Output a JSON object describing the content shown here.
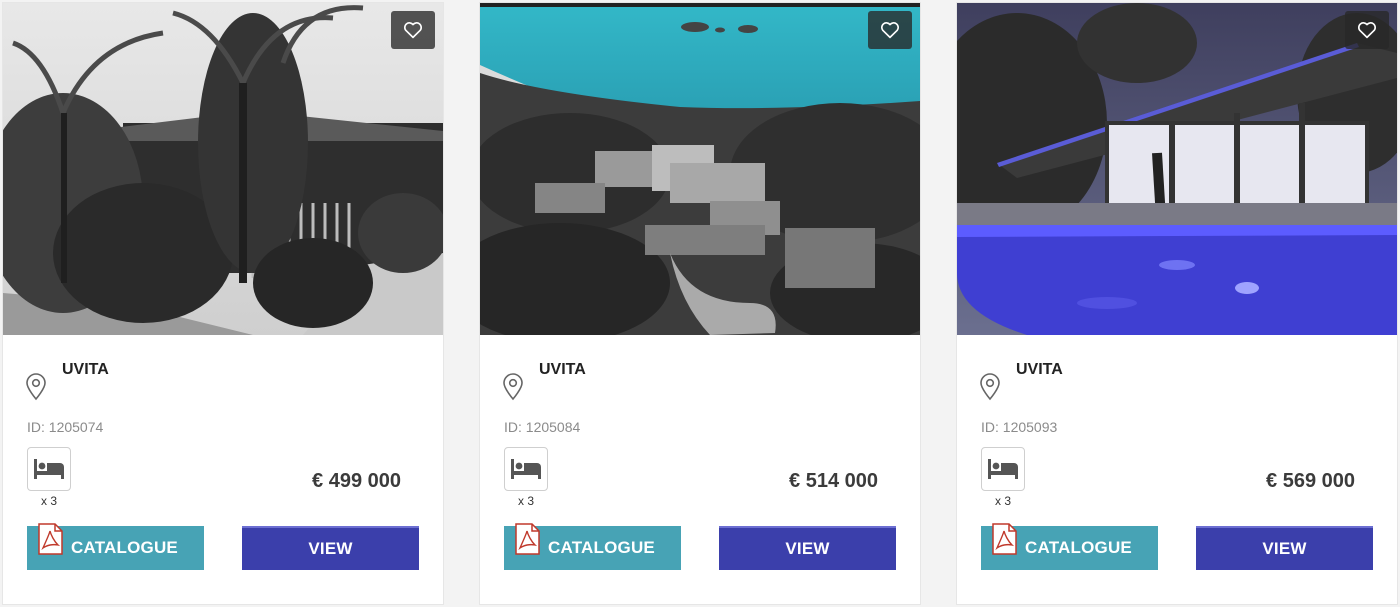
{
  "colors": {
    "catalogue_button": "#47a3b5",
    "view_button": "#3b3fab",
    "favorite_button_bg": "#2a2a2a",
    "card_bg": "#ffffff",
    "page_bg": "#f3f3f3"
  },
  "icons": {
    "favorite": "heart-outline-icon",
    "location": "map-pin-icon",
    "bedrooms": "bed-icon",
    "catalogue": "pdf-file-icon"
  },
  "listings": [
    {
      "photo_subject": "tropical garden house",
      "city": "UVITA",
      "reference": "ID: 1205074",
      "bedrooms": "x 3",
      "price": "€ 499 000",
      "catalogue_label": "CATALOGUE",
      "view_label": "VIEW"
    },
    {
      "photo_subject": "aerial ocean view",
      "city": "UVITA",
      "reference": "ID: 1205084",
      "bedrooms": "x 3",
      "price": "€ 514 000",
      "catalogue_label": "CATALOGUE",
      "view_label": "VIEW"
    },
    {
      "photo_subject": "pool villa at night",
      "city": "UVITA",
      "reference": "ID: 1205093",
      "bedrooms": "x 3",
      "price": "€ 569 000",
      "catalogue_label": "CATALOGUE",
      "view_label": "VIEW"
    }
  ]
}
